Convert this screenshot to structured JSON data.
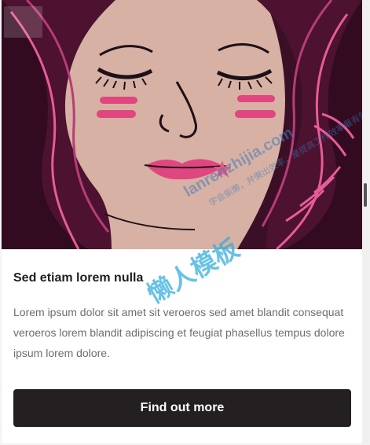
{
  "card": {
    "title": "Sed etiam lorem nulla",
    "description": "Lorem ipsum dolor sit amet sit veroeros sed amet blandit consequat veroeros lorem blandit adipiscing et feugiat phasellus tempus dolore ipsum lorem dolore.",
    "button_label": "Find out more"
  },
  "watermark": {
    "site": "lanrenzhijia.com",
    "sub": "学会偷懒，并懒出效率，是提高工作效率最有效的方法！",
    "name": "懒人模板"
  },
  "colors": {
    "hero_bg": "#3a0f25",
    "button_bg": "#242021",
    "title_text": "#1f1f1f",
    "body_text": "#6d6d6d"
  },
  "icons": {
    "top_left": "overlay-button"
  }
}
